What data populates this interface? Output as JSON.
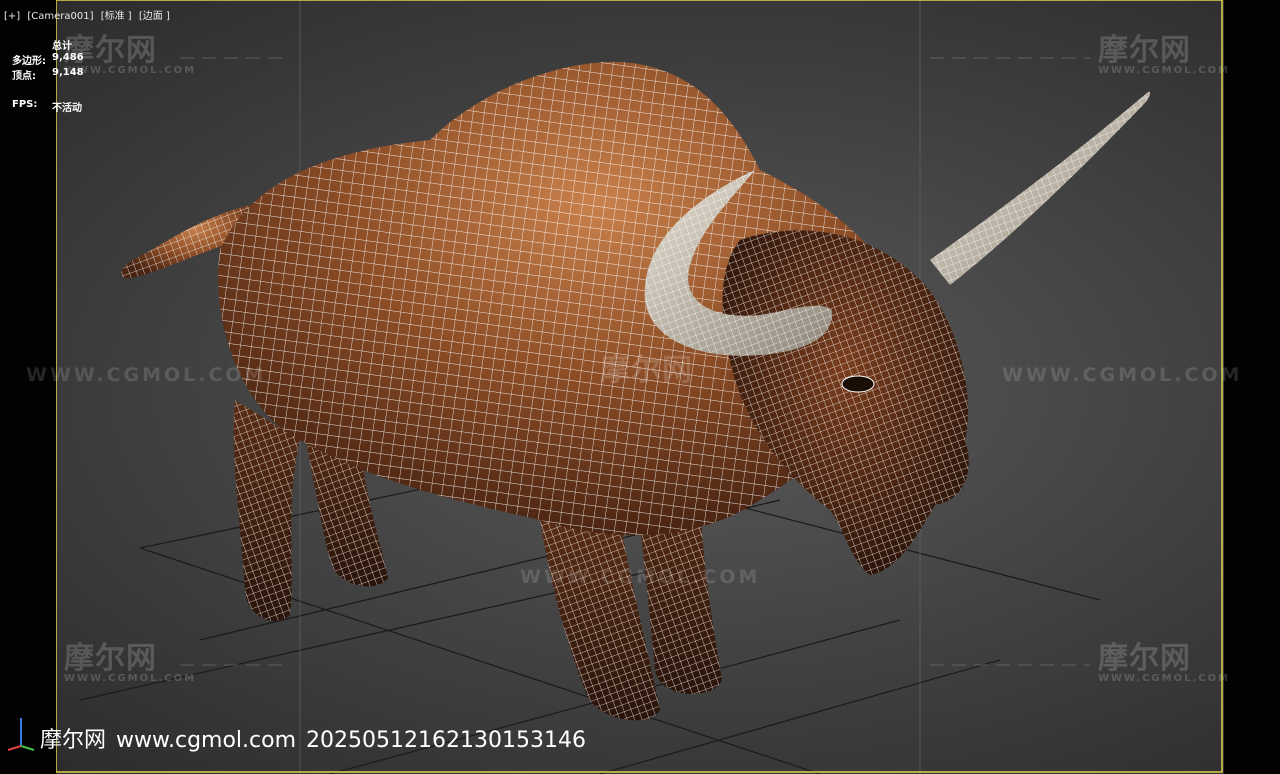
{
  "viewport": {
    "label_parts": [
      "[+]",
      "[Camera001]",
      "[标准 ]",
      "[边面 ]"
    ]
  },
  "stats": {
    "total_label": "总计",
    "polygons_label": "多边形:",
    "polygons_value": "9,486",
    "vertices_label": "顶点:",
    "vertices_value": "9,148",
    "fps_label": "FPS:",
    "fps_value": "不活动"
  },
  "watermark": {
    "logo": "摩尔网",
    "sub": "WWW.CGMOL.COM",
    "url": "WWW.CGMOL.COM"
  },
  "footer": {
    "site_name": "摩尔网",
    "url": "www.cgmol.com",
    "id": "20250512162130153146"
  },
  "colors": {
    "viewport_border": "#e0d24a",
    "wireframe": "#ffffff",
    "fur": "#8a4a22",
    "horn": "#cfc6b4",
    "grid": "#1a1a1a"
  },
  "icons": [
    "axis-gizmo-icon"
  ]
}
